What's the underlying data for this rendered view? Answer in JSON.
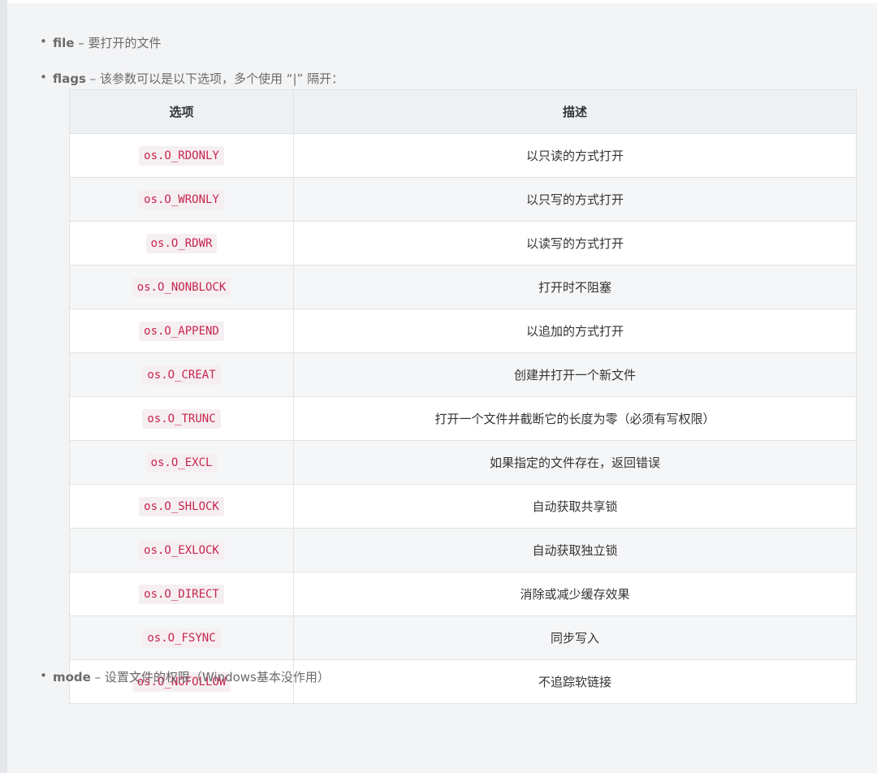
{
  "params": {
    "file": {
      "bullet": "•",
      "name": "file",
      "desc": " – 要打开的文件"
    },
    "flags": {
      "bullet": "•",
      "name": "flags",
      "desc": " – 该参数可以是以下选项，多个使用 “|” 隔开："
    },
    "mode": {
      "bullet": "•",
      "name": "mode",
      "desc": " – 设置文件的权限（Windows基本没作用）"
    }
  },
  "table": {
    "headers": [
      "选项",
      "描述"
    ],
    "rows": [
      {
        "option": "os.O_RDONLY",
        "desc": "以只读的方式打开"
      },
      {
        "option": "os.O_WRONLY",
        "desc": "以只写的方式打开"
      },
      {
        "option": "os.O_RDWR",
        "desc": "以读写的方式打开"
      },
      {
        "option": "os.O_NONBLOCK",
        "desc": "打开时不阻塞"
      },
      {
        "option": "os.O_APPEND",
        "desc": "以追加的方式打开"
      },
      {
        "option": "os.O_CREAT",
        "desc": "创建并打开一个新文件"
      },
      {
        "option": "os.O_TRUNC",
        "desc": "打开一个文件并截断它的长度为零（必须有写权限）"
      },
      {
        "option": "os.O_EXCL",
        "desc": "如果指定的文件存在，返回错误"
      },
      {
        "option": "os.O_SHLOCK",
        "desc": "自动获取共享锁"
      },
      {
        "option": "os.O_EXLOCK",
        "desc": "自动获取独立锁"
      },
      {
        "option": "os.O_DIRECT",
        "desc": "消除或减少缓存效果"
      },
      {
        "option": "os.O_FSYNC",
        "desc": "同步写入"
      },
      {
        "option": "os.O_NOFOLLOW",
        "desc": "不追踪软链接"
      }
    ]
  },
  "colors": {
    "code_text": "#c7254e",
    "code_bg": "#f6eff1",
    "page_bg": "#f3f4f6",
    "header_bg": "#eef1f4"
  }
}
